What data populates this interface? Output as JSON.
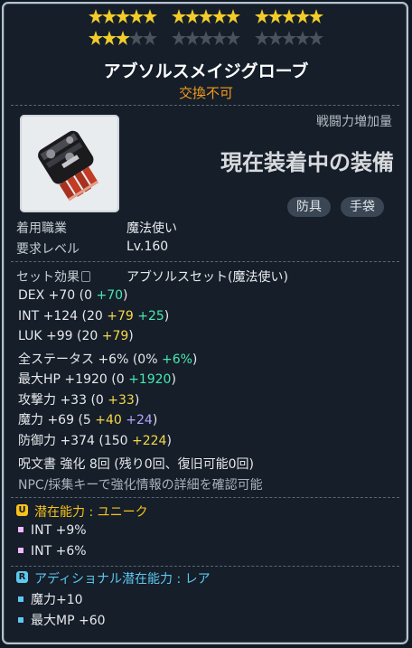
{
  "stars": {
    "groups": [
      {
        "filled": 5,
        "total": 5
      },
      {
        "filled": 5,
        "total": 5
      },
      {
        "filled": 5,
        "total": 5
      },
      {
        "filled": 3,
        "total": 5
      },
      {
        "filled": 0,
        "total": 5
      },
      {
        "filled": 0,
        "total": 5
      }
    ]
  },
  "item": {
    "name": "アブソルスメイジグローブ",
    "trade_status": "交換不可"
  },
  "combat_power_label": "戦闘力増加量",
  "equipped_text": "現在装着中の装備",
  "tags": [
    "防具",
    "手袋"
  ],
  "requirements": {
    "job_label": "着用職業",
    "job_value": "魔法使い",
    "level_label": "要求レベル",
    "level_value": "Lv.160"
  },
  "set_effect": {
    "label": "セット効果",
    "value": "アブソルスセット(魔法使い)"
  },
  "stats": [
    {
      "name": "DEX",
      "total": "+70",
      "base": "0",
      "bonus": [
        {
          "value": "+70",
          "color": "green"
        }
      ]
    },
    {
      "name": "INT",
      "total": "+124",
      "base": "20",
      "bonus": [
        {
          "value": "+79",
          "color": "yellow"
        },
        {
          "value": "+25",
          "color": "green"
        }
      ]
    },
    {
      "name": "LUK",
      "total": "+99",
      "base": "20",
      "bonus": [
        {
          "value": "+79",
          "color": "yellow"
        }
      ]
    },
    {
      "name": "全ステータス",
      "total": "+6%",
      "base": "0%",
      "bonus": [
        {
          "value": "+6%",
          "color": "green"
        }
      ]
    },
    {
      "name": "最大HP",
      "total": "+1920",
      "base": "0",
      "bonus": [
        {
          "value": "+1920",
          "color": "green"
        }
      ]
    },
    {
      "name": "攻撃力",
      "total": "+33",
      "base": "0",
      "bonus": [
        {
          "value": "+33",
          "color": "yellow"
        }
      ]
    },
    {
      "name": "魔力",
      "total": "+69",
      "base": "5",
      "bonus": [
        {
          "value": "+40",
          "color": "yellow"
        },
        {
          "value": "+24",
          "color": "purple"
        }
      ]
    },
    {
      "name": "防御力",
      "total": "+374",
      "base": "150",
      "bonus": [
        {
          "value": "+224",
          "color": "yellow"
        }
      ]
    }
  ],
  "enhance_text": "呪文書 強化 8回 (残り0回、復旧可能0回)",
  "npc_text": "NPC/採集キーで強化情報の詳細を確認可能",
  "potential": {
    "badge": "U",
    "title": "潜在能力 : ユニーク",
    "color": "#f6c21a",
    "lines": [
      "INT +9%",
      "INT +6%"
    ]
  },
  "additional": {
    "badge": "R",
    "title": "アディショナル潜在能力 : レア",
    "color": "#5ec8f0",
    "lines": [
      "魔力+10",
      "最大MP +60"
    ]
  }
}
